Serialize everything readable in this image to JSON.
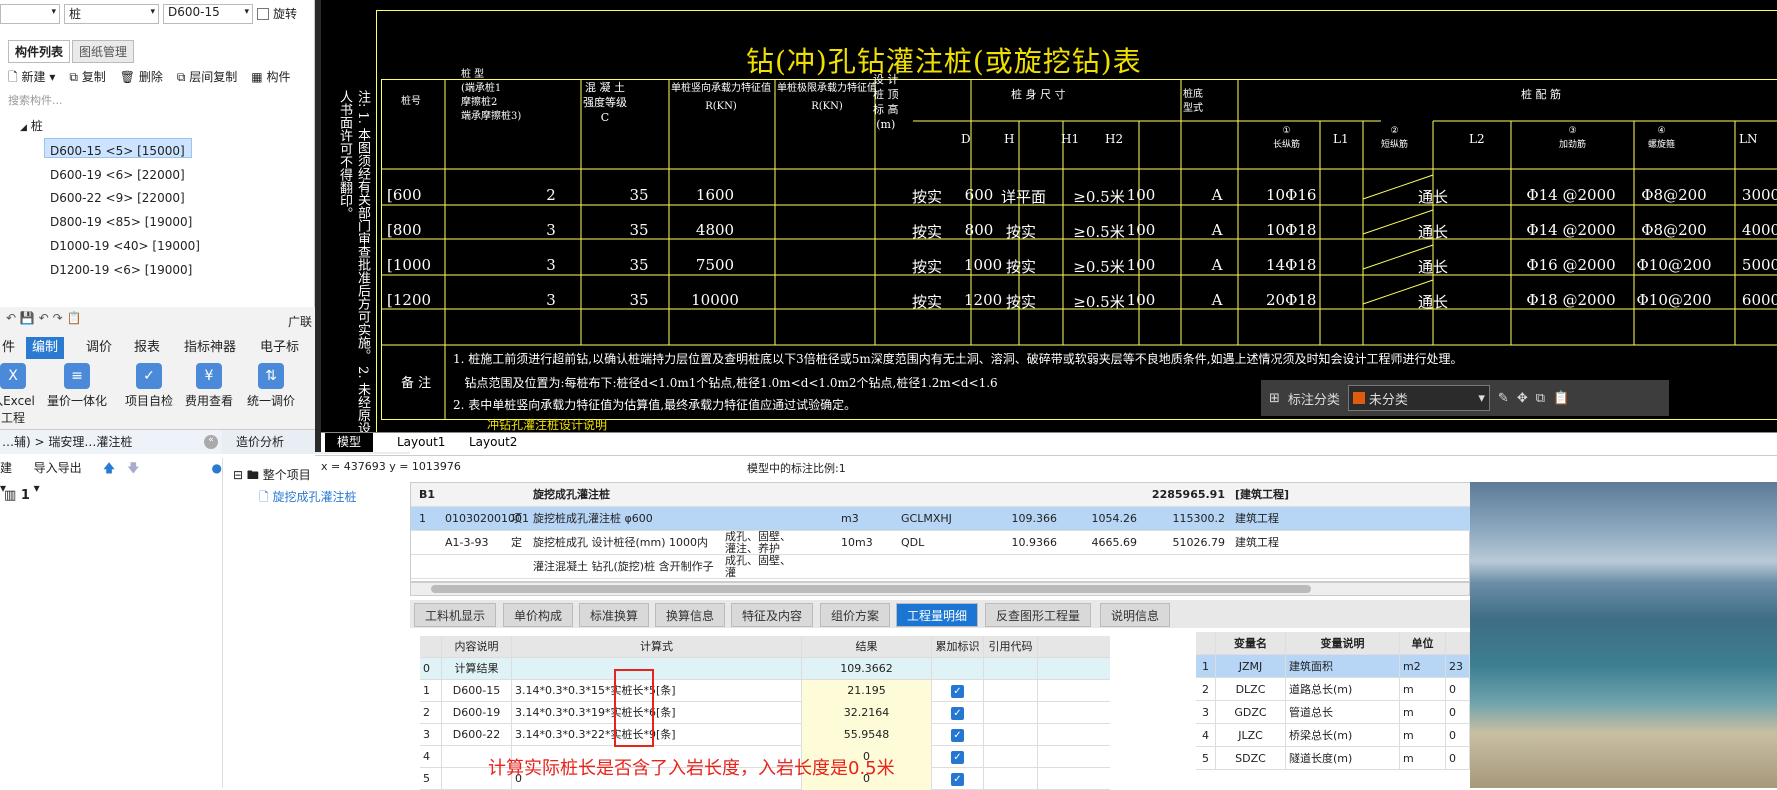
{
  "top_toolbar": {
    "combo1": "",
    "combo2": "桩",
    "combo3": "D600-15",
    "rotate_label": "旋转"
  },
  "left_panel": {
    "tabs": [
      "构件列表",
      "图纸管理"
    ],
    "toolbar": [
      "新建",
      "复制",
      "删除",
      "层间复制",
      "构件"
    ],
    "search_placeholder": "搜索构件...",
    "tree_root": "桩",
    "items": [
      "D600-15 <5> [15000]",
      "D600-19 <6> [22000]",
      "D600-22 <9> [22000]",
      "D800-19 <85> [19000]",
      "D1000-19 <40> [19000]",
      "D1200-19 <6> [19000]"
    ]
  },
  "ribbon": {
    "app_title": "广联",
    "tabs": [
      "件",
      "编制",
      "调价",
      "报表",
      "指标神器",
      "电子标"
    ],
    "buttons": [
      "入Excel\n工程",
      "量价一体化",
      "项目自检",
      "费用查看",
      "统一调价"
    ]
  },
  "lower_left": {
    "breadcrumb": "…辅)  >  瑞安理…灌注桩",
    "section_tab": "造价分析",
    "toolbar": [
      "建",
      "导入导出"
    ],
    "node": "1",
    "tree_root": "整个项目",
    "tree_child": "旋挖成孔灌注桩"
  },
  "cad": {
    "title": "钻(冲)孔钻灌注桩(或旋挖钻)表",
    "vertical_note": "注: 1. 本图须经有关部门审查批准后方可实施。 2. 未经原设计人书面许可不得翻印。",
    "headers": {
      "pile_no": "桩号",
      "pile_type": "桩 型\n(端承桩1\n摩擦桩2\n端承摩擦桩3)",
      "concrete": "混 凝 土\n强度等级\nC",
      "capacity": "单桩竖向承载力特征值\nR(KN)",
      "limit": "单桩极限承载力特征值\nR(KN)",
      "design_top": "设 计\n桩 顶\n标 高\n(m)",
      "size": "桩 身 尺 寸",
      "bottom": "桩底\n型式",
      "rebar": "桩 配 筋",
      "D": "D",
      "H": "H",
      "H1": "H1",
      "H2": "H2",
      "c1": "①\n长纵筋",
      "L1": "L1",
      "c2": "②\n短纵筋",
      "L2": "L2",
      "c3": "③\n加劲筋",
      "c4": "④\n螺旋箍",
      "LN": "LN"
    },
    "rows": [
      {
        "id": "[600",
        "type": "2",
        "c": "35",
        "r": "1600",
        "top": "按实",
        "d": "600",
        "h": "详平面",
        "h1": "≥0.5米",
        "h2": "100",
        "base": "A",
        "long": "10Φ16",
        "l1": "通长",
        "hoop": "Φ14 @2000",
        "spiral": "Φ8@200",
        "ln": "3000"
      },
      {
        "id": "[800",
        "type": "3",
        "c": "35",
        "r": "4800",
        "top": "按实",
        "d": "800",
        "h": "按实",
        "h1": "≥0.5米",
        "h2": "100",
        "base": "A",
        "long": "10Φ18",
        "l1": "通长",
        "hoop": "Φ14 @2000",
        "spiral": "Φ8@200",
        "ln": "4000"
      },
      {
        "id": "[1000",
        "type": "3",
        "c": "35",
        "r": "7500",
        "top": "按实",
        "d": "1000",
        "h": "按实",
        "h1": "≥0.5米",
        "h2": "100",
        "base": "A",
        "long": "14Φ18",
        "l1": "通长",
        "hoop": "Φ16 @2000",
        "spiral": "Φ10@200",
        "ln": "5000"
      },
      {
        "id": "[1200",
        "type": "3",
        "c": "35",
        "r": "10000",
        "top": "按实",
        "d": "1200",
        "h": "按实",
        "h1": "≥0.5米",
        "h2": "100",
        "base": "A",
        "long": "20Φ18",
        "l1": "通长",
        "hoop": "Φ18 @2000",
        "spiral": "Φ10@200",
        "ln": "6000"
      }
    ],
    "remark_label": "备 注",
    "remarks": [
      "1. 桩施工前须进行超前钻,以确认桩端持力层位置及查明桩底以下3倍桩径或5m深度范围内有无土洞、溶洞、破碎带或软弱夹层等不良地质条件,如遇上述情况须及时知会设计工程师进行处理。",
      "   钻点范围及位置为:每桩布下:桩径d<1.0m1个钻点,桩径1.0m<d<1.0m2个钻点,桩径1.2m<d<1.6",
      "2. 表中单桩竖向承载力特征值为估算值,最终承载力特征值应通过试验确定。"
    ],
    "remarks_cut": "冲钻孔灌注桩设计说明",
    "tabs": [
      "模型",
      "Layout1",
      "Layout2"
    ]
  },
  "cad_float": {
    "label": "标注分类",
    "value": "未分类"
  },
  "status": {
    "coords": "x = 437693  y = 1013976",
    "scale": "模型中的标注比例:1"
  },
  "bill": {
    "rows": [
      {
        "no": "B1",
        "code": "",
        "kind": "",
        "name": "旋挖成孔灌注桩",
        "feature": "",
        "unit": "",
        "formula": "",
        "qty": "",
        "price": "",
        "total": "2285965.91",
        "cat": "[建筑工程]"
      },
      {
        "no": "1",
        "code": "010302001001",
        "kind": "项",
        "name": "旋挖桩成孔灌注桩 φ600",
        "feature": "",
        "unit": "m3",
        "formula": "GCLMXHJ",
        "qty": "109.366",
        "price": "1054.26",
        "total": "115300.2",
        "cat": "建筑工程"
      },
      {
        "no": "",
        "code": "A1-3-93",
        "kind": "定",
        "name": "旋挖桩成孔 设计桩径(mm) 1000内",
        "feature": "成孔、固壁、灌注、养护",
        "unit": "10m3",
        "formula": "QDL",
        "qty": "10.9366",
        "price": "4665.69",
        "total": "51026.79",
        "cat": "建筑工程"
      },
      {
        "no": "",
        "code": "",
        "kind": "",
        "name": "灌注混凝土 钻孔(旋挖)桩 含开制作子",
        "feature": "成孔、固壁、灌",
        "unit": "",
        "formula": "",
        "qty": "",
        "price": "",
        "total": "",
        "cat": ""
      }
    ]
  },
  "bottom_tabs": [
    "工料机显示",
    "单价构成",
    "标准换算",
    "换算信息",
    "特征及内容",
    "组价方案",
    "工程量明细",
    "反查图形工程量",
    "说明信息"
  ],
  "calc": {
    "headers": [
      "内容说明",
      "计算式",
      "结果",
      "累加标识",
      "引用代码"
    ],
    "rows": [
      {
        "n": "0",
        "desc": "计算结果",
        "expr": "",
        "res": "109.3662",
        "check": false
      },
      {
        "n": "1",
        "desc": "D600-15",
        "expr": "3.14*0.3*0.3*15*实桩长*5[条]",
        "res": "21.195",
        "check": true
      },
      {
        "n": "2",
        "desc": "D600-19",
        "expr": "3.14*0.3*0.3*19*实桩长*6[条]",
        "res": "32.2164",
        "check": true
      },
      {
        "n": "3",
        "desc": "D600-22",
        "expr": "3.14*0.3*0.3*22*实桩长*9[条]",
        "res": "55.9548",
        "check": true
      },
      {
        "n": "4",
        "desc": "",
        "expr": "",
        "res": "0",
        "check": true
      },
      {
        "n": "5",
        "desc": "",
        "expr": "0",
        "res": "0",
        "check": true
      }
    ],
    "annotation": "计算实际桩长是否含了入岩长度，入岩长度是0.5米"
  },
  "vars": {
    "headers": [
      "变量名",
      "变量说明",
      "单位"
    ],
    "rows": [
      {
        "n": "1",
        "name": "JZMJ",
        "desc": "建筑面积",
        "unit": "m2",
        "v": "23"
      },
      {
        "n": "2",
        "name": "DLZC",
        "desc": "道路总长(m)",
        "unit": "m",
        "v": "0"
      },
      {
        "n": "3",
        "name": "GDZC",
        "desc": "管道总长",
        "unit": "m",
        "v": "0"
      },
      {
        "n": "4",
        "name": "JLZC",
        "desc": "桥梁总长(m)",
        "unit": "m",
        "v": "0"
      },
      {
        "n": "5",
        "name": "SDZC",
        "desc": "隧道长度(m)",
        "unit": "m",
        "v": "0"
      }
    ]
  },
  "colors": {
    "accent": "#1a76d2",
    "cad_yellow": "#f0e000",
    "highlight": "#cce4ff",
    "annotation_red": "#e8231c"
  }
}
